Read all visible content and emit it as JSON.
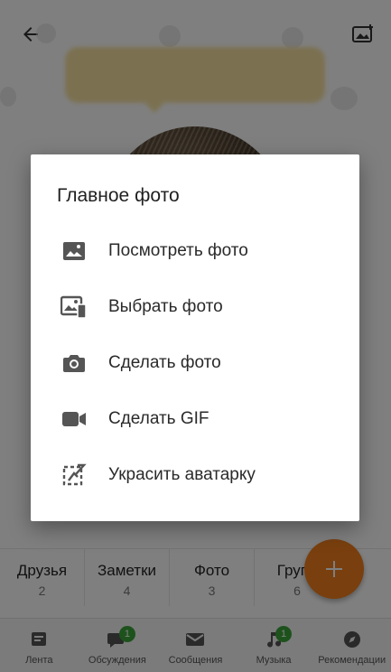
{
  "background": {
    "stats": [
      {
        "label": "Друзья",
        "count": "2"
      },
      {
        "label": "Заметки",
        "count": "4"
      },
      {
        "label": "Фото",
        "count": "3"
      },
      {
        "label": "Групп",
        "count": "6"
      }
    ],
    "bottom_nav": [
      {
        "label": "Лента",
        "icon": "feed-icon",
        "badge": ""
      },
      {
        "label": "Обсуждения",
        "icon": "discussions-icon",
        "badge": "1"
      },
      {
        "label": "Сообщения",
        "icon": "messages-icon",
        "badge": ""
      },
      {
        "label": "Музыка",
        "icon": "music-icon",
        "badge": "1"
      },
      {
        "label": "Рекомендации",
        "icon": "compass-icon",
        "badge": ""
      }
    ],
    "fab_icon": "plus-icon",
    "accent_color": "#f27e1c",
    "badge_color": "#3aa53a"
  },
  "dialog": {
    "title": "Главное фото",
    "items": [
      {
        "label": "Посмотреть фото",
        "icon": "image-icon"
      },
      {
        "label": "Выбрать фото",
        "icon": "gallery-device-icon"
      },
      {
        "label": "Сделать фото",
        "icon": "camera-icon"
      },
      {
        "label": "Сделать GIF",
        "icon": "video-camera-icon"
      },
      {
        "label": "Украсить аватарку",
        "icon": "decorate-avatar-icon"
      }
    ]
  }
}
